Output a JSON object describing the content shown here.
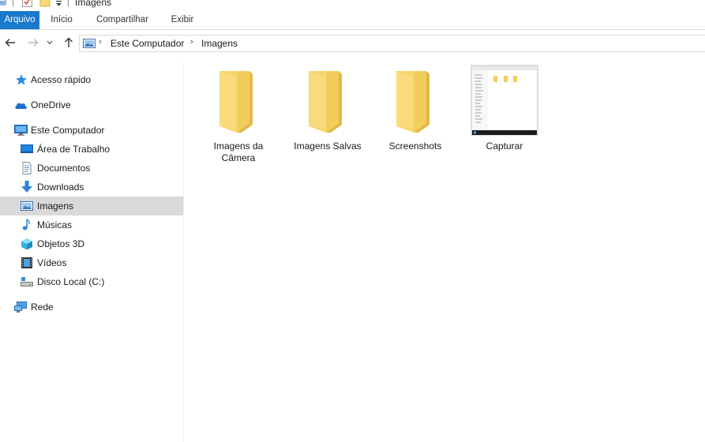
{
  "window": {
    "title": "Imagens"
  },
  "ribbon": {
    "tabs": [
      {
        "label": "Arquivo"
      },
      {
        "label": "Início"
      },
      {
        "label": "Compartilhar"
      },
      {
        "label": "Exibir"
      }
    ]
  },
  "address": {
    "crumbs": [
      {
        "label": "Este Computador"
      },
      {
        "label": "Imagens"
      }
    ]
  },
  "nav": {
    "items": [
      {
        "label": "Acesso rápido",
        "icon": "star-icon"
      },
      {
        "label": "OneDrive",
        "icon": "cloud-icon"
      },
      {
        "label": "Este Computador",
        "icon": "computer-icon"
      },
      {
        "label": "Área de Trabalho",
        "icon": "desktop-icon"
      },
      {
        "label": "Documentos",
        "icon": "documents-icon"
      },
      {
        "label": "Downloads",
        "icon": "download-icon"
      },
      {
        "label": "Imagens",
        "icon": "pictures-icon",
        "selected": true
      },
      {
        "label": "Músicas",
        "icon": "music-icon"
      },
      {
        "label": "Objetos 3D",
        "icon": "cube-icon"
      },
      {
        "label": "Vídeos",
        "icon": "video-icon"
      },
      {
        "label": "Disco Local (C:)",
        "icon": "drive-icon"
      },
      {
        "label": "Rede",
        "icon": "network-icon"
      }
    ]
  },
  "content": {
    "items": [
      {
        "label": "Imagens da Câmera",
        "icon": "folder-icon"
      },
      {
        "label": "Imagens Salvas",
        "icon": "folder-icon"
      },
      {
        "label": "Screenshots",
        "icon": "folder-icon"
      },
      {
        "label": "Capturar",
        "icon": "image-thumbnail-icon"
      }
    ]
  },
  "colors": {
    "accent": "#1979ca",
    "folder": "#f8d775",
    "selection": "#d9d9d9"
  }
}
